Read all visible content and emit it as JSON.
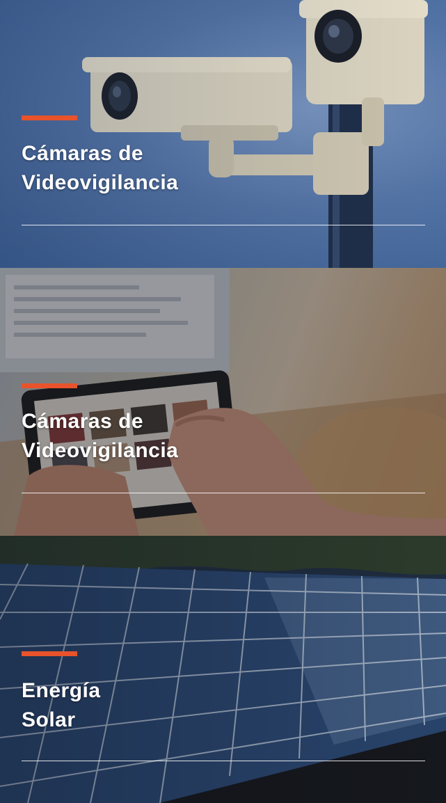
{
  "cards": [
    {
      "id": "cctv",
      "title_lines": [
        "Cámaras de",
        "Videovigilancia"
      ],
      "image_subject": "security-cameras-on-pole"
    },
    {
      "id": "tablet",
      "title_lines": [
        "Cámaras de",
        "Videovigilancia"
      ],
      "image_subject": "hand-using-tablet"
    },
    {
      "id": "solar",
      "title_lines": [
        "Energía",
        "Solar"
      ],
      "image_subject": "solar-panel-array"
    }
  ],
  "colors": {
    "accent": "#e8532b",
    "title": "#ffffff",
    "rule": "#ffffff"
  }
}
